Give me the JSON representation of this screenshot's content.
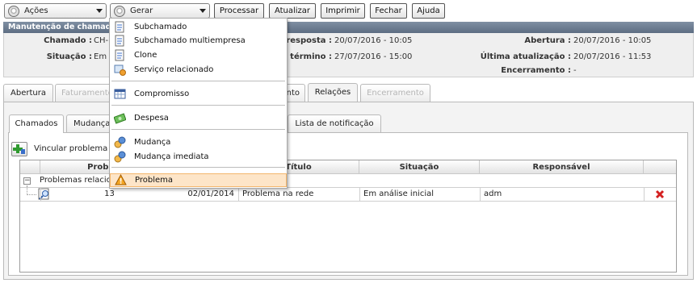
{
  "toolbar": {
    "acoes": "Ações",
    "gerar": "Gerar",
    "processar": "Processar",
    "atualizar": "Atualizar",
    "imprimir": "Imprimir",
    "fechar": "Fechar",
    "ajuda": "Ajuda"
  },
  "panel": {
    "title": "Manutenção de chamado",
    "chamado_label": "Chamado :",
    "chamado_value": "CH-",
    "situacao_label": "Situação :",
    "situacao_value": "Em",
    "prazo_resposta_label": "e resposta :",
    "prazo_resposta_value": "20/07/2016 - 10:05",
    "prazo_termino_label": "e término :",
    "prazo_termino_value": "27/07/2016 - 15:00",
    "abertura_label": "Abertura :",
    "abertura_value": "20/07/2016 - 10:05",
    "ultima_label": "Última atualização :",
    "ultima_value": "20/07/2016 - 11:53",
    "encerramento_label": "Encerramento :",
    "encerramento_value": "-"
  },
  "tabs": {
    "abertura": "Abertura",
    "faturamento": "Faturamento",
    "hidden_tab": "nto",
    "relacoes": "Relações",
    "encerramento": "Encerramento"
  },
  "subtabs": {
    "chamados": "Chamados",
    "mudanca": "Mudança",
    "notificacao": "Lista de notificação"
  },
  "vincular": "Vincular problema",
  "grid": {
    "headers": {
      "problema": "Problema",
      "titulo": "Título",
      "situacao": "Situação",
      "responsavel": "Responsável"
    },
    "group_label": "Problemas relacio",
    "row": {
      "numero": "13",
      "data": "02/01/2014",
      "titulo": "Problema na rede",
      "situacao": "Em análise inicial",
      "responsavel": "adm"
    }
  },
  "menu": {
    "items": [
      {
        "label": "Subchamado",
        "icon": "document-icon"
      },
      {
        "label": "Subchamado multiempresa",
        "icon": "document-icon"
      },
      {
        "label": "Clone",
        "icon": "document-icon"
      },
      {
        "label": "Serviço relacionado",
        "icon": "service-icon"
      },
      {
        "label": "Compromisso",
        "icon": "calendar-icon"
      },
      {
        "label": "Despesa",
        "icon": "money-icon"
      },
      {
        "label": "Mudança",
        "icon": "change-icon"
      },
      {
        "label": "Mudança imediata",
        "icon": "change-icon"
      },
      {
        "label": "Problema",
        "icon": "warning-icon"
      }
    ],
    "selected": "Problema"
  }
}
